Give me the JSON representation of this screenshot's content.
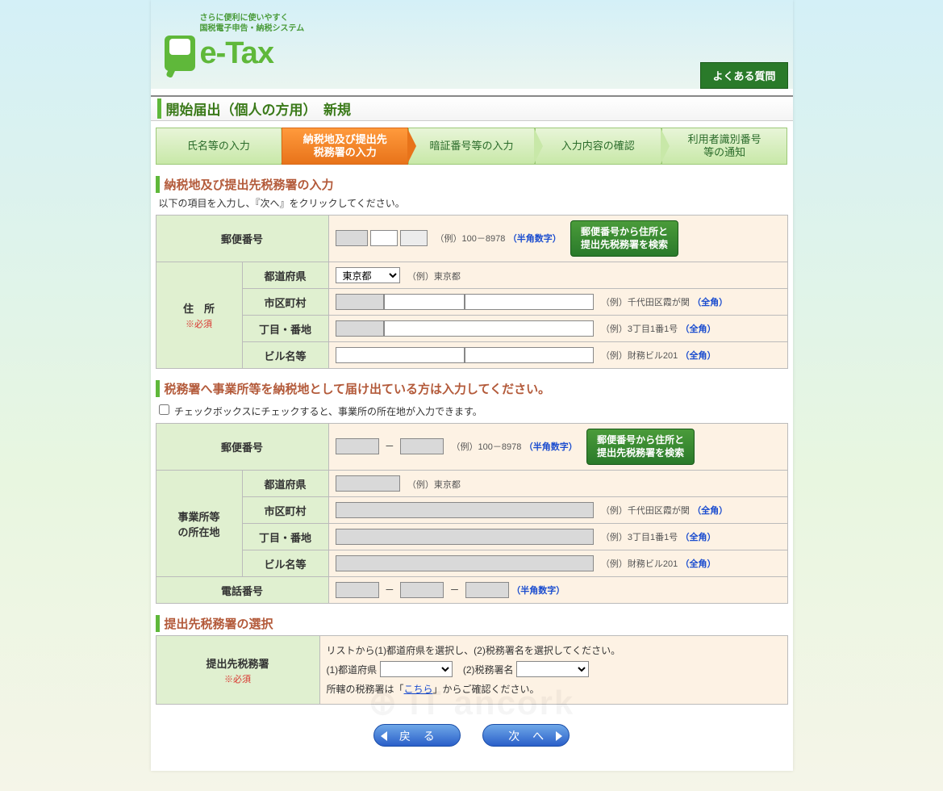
{
  "header": {
    "tag1": "さらに便利に使いやすく",
    "tag2": "国税電子申告・納税システム",
    "logo": "e-Tax",
    "faq": "よくある質問"
  },
  "page_title": "開始届出（個人の方用）　新規",
  "steps": [
    "氏名等の入力",
    "納税地及び提出先\n税務署の入力",
    "暗証番号等の入力",
    "入力内容の確認",
    "利用者識別番号\n等の通知"
  ],
  "section1": {
    "title": "納税地及び提出先税務署の入力",
    "note": "以下の項目を入力し、『次へ』をクリックしてください。"
  },
  "labels": {
    "postal": "郵便番号",
    "address": "住　所",
    "required": "※必須",
    "pref": "都道府県",
    "city": "市区町村",
    "block": "丁目・番地",
    "bldg": "ビル名等",
    "office_loc": "事業所等\nの所在地",
    "tel": "電話番号",
    "submit_office": "提出先税務署"
  },
  "pref_value": "東京都",
  "hints": {
    "postal_ex": "（例）100－8978",
    "pref_ex": "（例）東京都",
    "city_ex": "（例）千代田区霞が関",
    "block_ex": "（例）3丁目1番1号",
    "bldg_ex": "（例）財務ビル201",
    "half_num": "（半角数字）",
    "full": "（全角）"
  },
  "btn": {
    "postal_lookup": "郵便番号から住所と\n提出先税務署を検索",
    "back": "戻 る",
    "next": "次 へ"
  },
  "section2": {
    "title": "税務署へ事業所等を納税地として届け出ている方は入力してください。",
    "check_note": "チェックボックスにチェックすると、事業所の所在地が入力できます。"
  },
  "section3": {
    "title": "提出先税務署の選択",
    "line1": "リストから(1)都道府県を選択し、(2)税務署名を選択してください。",
    "l1": "(1)都道府県",
    "l2": "(2)税務署名",
    "line3a": "所轄の税務署は「",
    "link": "こちら",
    "line3b": "」からご確認ください。"
  }
}
